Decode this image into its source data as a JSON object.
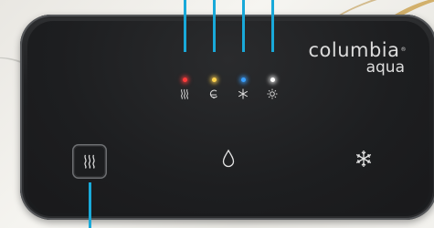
{
  "brand": {
    "name": "columbia",
    "registered_mark": "®",
    "sub": "aqua"
  },
  "indicators": [
    {
      "name": "hot-water-indicator",
      "led_color": "#ff3b3b",
      "icon": "heat-waves-icon"
    },
    {
      "name": "eco-indicator",
      "led_color": "#ffd34d",
      "icon": "eco-leaf-icon"
    },
    {
      "name": "cold-indicator",
      "led_color": "#3aa0ff",
      "icon": "asterisk-cold-icon"
    },
    {
      "name": "ambient-indicator",
      "led_color": "#ffffff",
      "icon": "sun-icon"
    }
  ],
  "buttons": [
    {
      "name": "hot-water-button",
      "icon": "heat-waves-icon"
    },
    {
      "name": "ambient-water-button",
      "icon": "water-drop-icon"
    },
    {
      "name": "cold-water-button",
      "icon": "snowflake-icon"
    }
  ],
  "colors": {
    "panel": "#1d1e20",
    "panel_border": "#55575a",
    "callout": "#19a9d9",
    "icon": "#d9d9d9"
  }
}
